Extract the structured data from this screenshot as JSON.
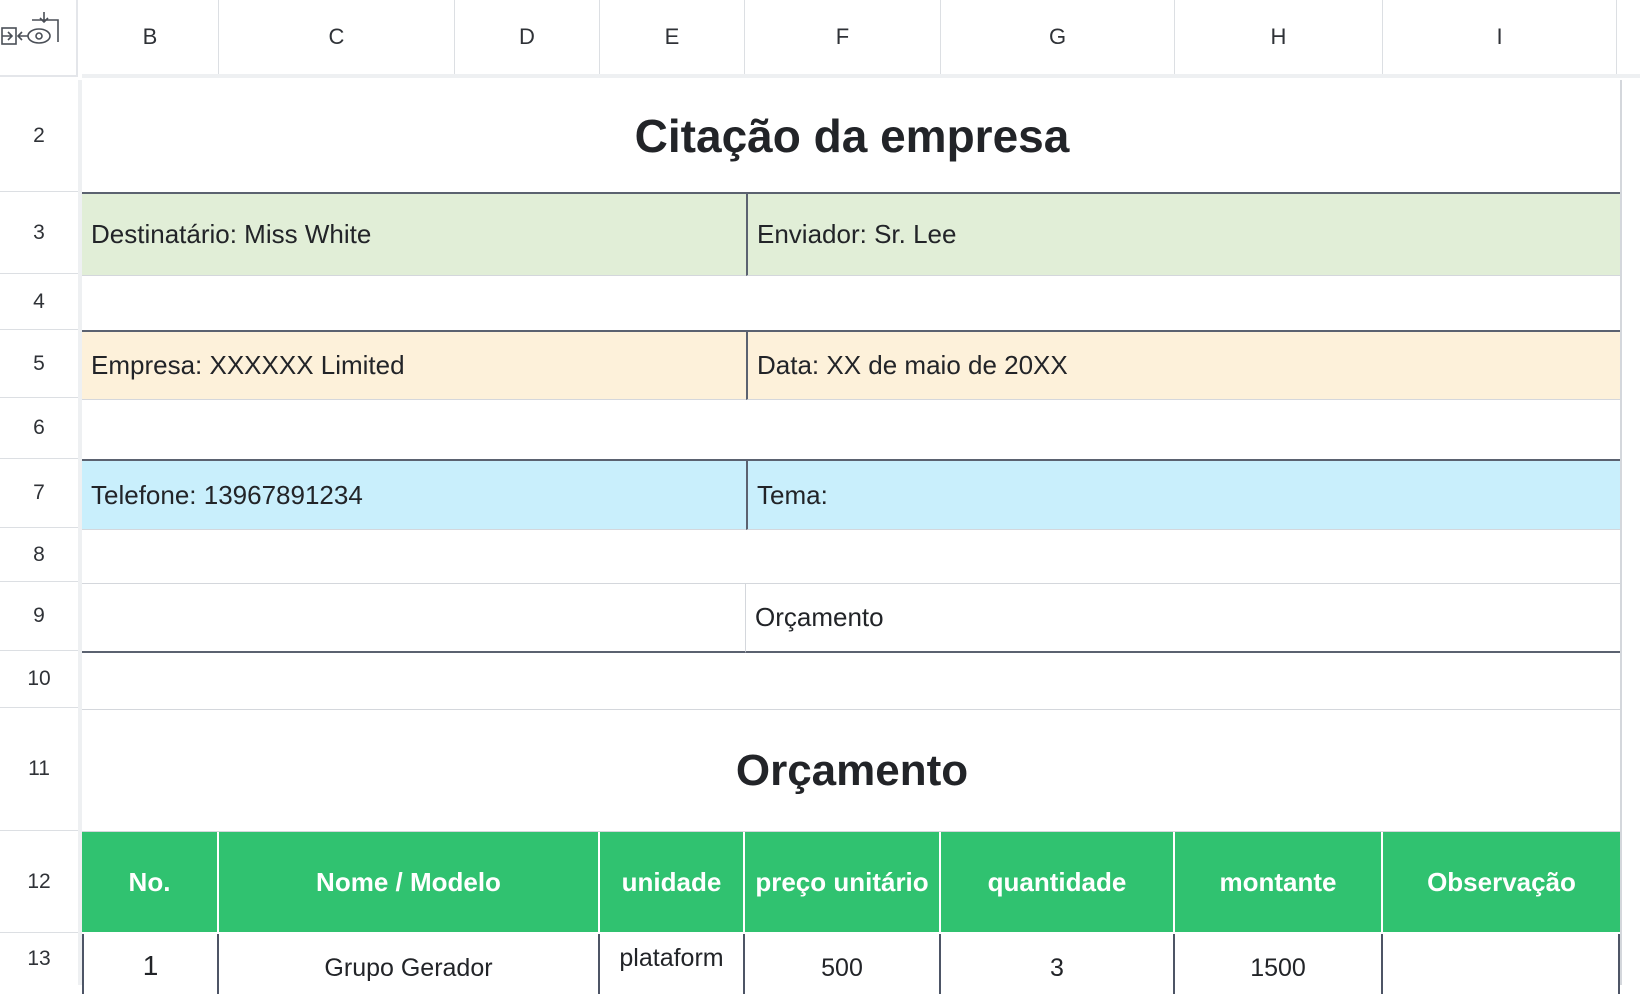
{
  "columns": [
    "B",
    "C",
    "D",
    "E",
    "F",
    "G",
    "H",
    "I"
  ],
  "rows": [
    "2",
    "3",
    "4",
    "5",
    "6",
    "7",
    "8",
    "9",
    "10",
    "11",
    "12",
    "13"
  ],
  "header": {
    "title": "Citação da empresa",
    "recipient": "Destinatário: Miss White",
    "sender": "Enviador: Sr. Lee",
    "company": "Empresa: XXXXXX Limited",
    "date": "Data: XX de maio de 20XX",
    "phone": "Telefone: 13967891234",
    "subject": "Tema:",
    "budget_label": "Orçamento"
  },
  "section": {
    "title": "Orçamento"
  },
  "table": {
    "columns": [
      "No.",
      "Nome / Modelo",
      "unidade",
      "preço unitário",
      "quantidade",
      "montante",
      "Observação"
    ],
    "rows": [
      {
        "no": "1",
        "name": "Grupo Gerador",
        "unit": "plataform",
        "price": "500",
        "qty": "3",
        "amount": "1500",
        "note": ""
      }
    ]
  },
  "colors": {
    "header_green": "#30c270",
    "row_green": "#e1eed7",
    "row_amber": "#fdf1da",
    "row_blue": "#c9effc"
  },
  "icons": {
    "corner": "view-freeze-icon"
  }
}
